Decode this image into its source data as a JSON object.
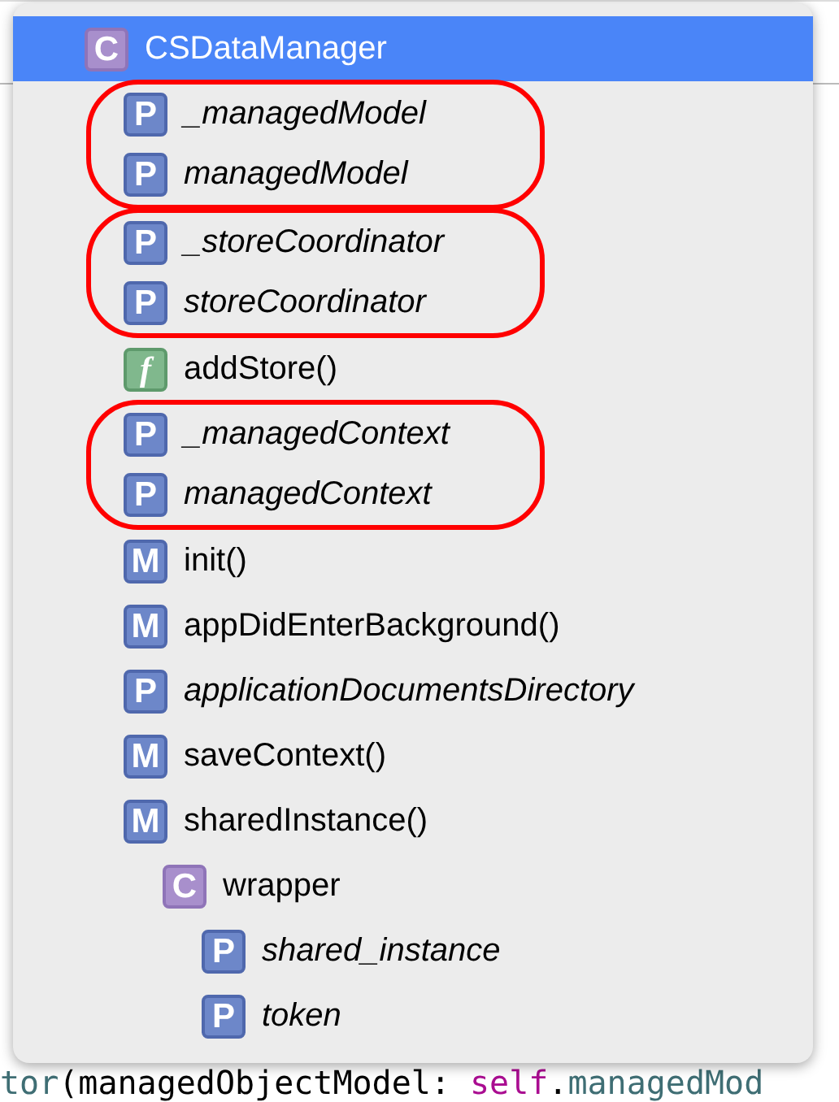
{
  "editor": {
    "lines": [
      {
        "tokens": [
          {
            "text": "tor",
            "kind": "type"
          },
          {
            "text": "(managedObjectModel: ",
            "kind": "plain"
          },
          {
            "text": "self",
            "kind": "keyword"
          },
          {
            "text": ".",
            "kind": "plain"
          },
          {
            "text": "managedMod",
            "kind": "type"
          }
        ]
      }
    ]
  },
  "popup": {
    "header": {
      "kind": "class",
      "icon": "C",
      "label": "CSDataManager",
      "selected": true
    },
    "items": [
      {
        "kind": "circled-group",
        "items": [
          {
            "kind": "property",
            "icon": "P",
            "label": "_managedModel",
            "selected": false
          },
          {
            "kind": "property",
            "icon": "P",
            "label": "managedModel",
            "selected": false
          }
        ]
      },
      {
        "kind": "circled-group",
        "items": [
          {
            "kind": "property",
            "icon": "P",
            "label": "_storeCoordinator",
            "selected": false
          },
          {
            "kind": "property",
            "icon": "P",
            "label": "storeCoordinator",
            "selected": false
          }
        ]
      },
      {
        "kind": "function",
        "icon": "f",
        "label": "addStore()",
        "selected": false
      },
      {
        "kind": "circled-group",
        "items": [
          {
            "kind": "property",
            "icon": "P",
            "label": "_managedContext",
            "selected": false
          },
          {
            "kind": "property",
            "icon": "P",
            "label": "managedContext",
            "selected": false
          }
        ]
      },
      {
        "kind": "method",
        "icon": "M",
        "label": "init()",
        "selected": false
      },
      {
        "kind": "method",
        "icon": "M",
        "label": "appDidEnterBackground()",
        "selected": false
      },
      {
        "kind": "property",
        "icon": "P",
        "label": "applicationDocumentsDirectory",
        "selected": false
      },
      {
        "kind": "method",
        "icon": "M",
        "label": "saveContext()",
        "selected": false
      },
      {
        "kind": "method",
        "icon": "M",
        "label": "sharedInstance()",
        "selected": false,
        "children": [
          {
            "kind": "class",
            "icon": "C",
            "label": "wrapper",
            "selected": false,
            "children": [
              {
                "kind": "property",
                "icon": "P",
                "label": "shared_instance",
                "selected": false
              },
              {
                "kind": "property",
                "icon": "P",
                "label": "token",
                "selected": false
              }
            ]
          }
        ]
      }
    ]
  }
}
